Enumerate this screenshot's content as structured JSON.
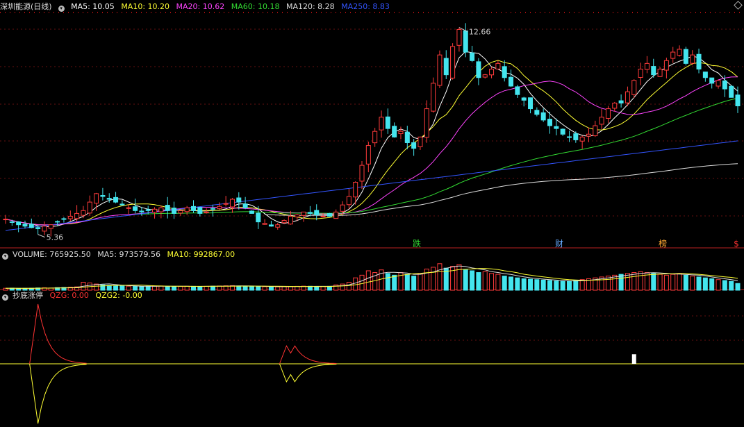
{
  "header": {
    "stock_name": "深圳能源",
    "period": "(日线)",
    "ma": [
      {
        "label": "MA5: 10.05",
        "color": "#ffffff"
      },
      {
        "label": "MA10: 10.20",
        "color": "#ffff33"
      },
      {
        "label": "MA20: 10.62",
        "color": "#ff44ff"
      },
      {
        "label": "MA60: 10.18",
        "color": "#33dd33"
      },
      {
        "label": "MA120: 8.28",
        "color": "#dddddd"
      },
      {
        "label": "MA250: 8.83",
        "color": "#3355ff"
      }
    ]
  },
  "volume_header": {
    "label": "VOLUME: 765925.50",
    "ma5": "MA5: 973579.56",
    "ma10": "MA10: 992867.00"
  },
  "indicator_header": {
    "name": "抄底涨停",
    "qzg": "QZG: 0.00",
    "qzg2": "QZG2: -0.00"
  },
  "chart_data": {
    "type": "candlestick",
    "high_label": "12.66",
    "low_label": "5.36",
    "markers": [
      {
        "text": "跌",
        "color": "#33dd33"
      },
      {
        "text": "财",
        "color": "#66aaff"
      },
      {
        "text": "榜",
        "color": "#ffaa33"
      },
      {
        "text": "$",
        "color": "#ff3333"
      }
    ],
    "price_range": [
      5.1,
      13.0
    ],
    "closes": [
      5.7,
      5.6,
      5.5,
      5.45,
      5.4,
      5.36,
      5.45,
      5.5,
      5.6,
      5.7,
      5.8,
      5.9,
      6.0,
      6.3,
      6.6,
      6.5,
      6.4,
      6.3,
      6.2,
      6.1,
      6.0,
      5.95,
      6.0,
      6.05,
      6.1,
      6.0,
      5.9,
      6.0,
      6.1,
      6.0,
      5.9,
      5.95,
      6.05,
      6.15,
      6.25,
      6.4,
      6.3,
      6.1,
      5.9,
      5.6,
      5.55,
      5.45,
      5.5,
      5.65,
      5.8,
      5.85,
      5.95,
      5.9,
      5.85,
      5.8,
      5.8,
      5.95,
      6.2,
      6.5,
      7.0,
      7.6,
      8.3,
      8.8,
      9.3,
      8.9,
      8.6,
      8.8,
      8.4,
      8.2,
      8.6,
      9.6,
      10.5,
      11.5,
      10.8,
      11.8,
      12.4,
      11.6,
      11.3,
      10.7,
      10.8,
      11.0,
      11.2,
      10.7,
      10.4,
      10.1,
      9.9,
      9.6,
      9.4,
      9.2,
      9.0,
      8.9,
      8.7,
      8.6,
      8.5,
      8.6,
      8.7,
      9.0,
      9.3,
      9.6,
      9.8,
      9.8,
      10.2,
      10.6,
      11.0,
      11.2,
      10.8,
      11.0,
      11.3,
      11.6,
      11.7,
      11.2,
      11.5,
      11.0,
      10.7,
      10.5,
      10.6,
      10.3,
      10.0,
      9.7
    ],
    "volume_range": [
      0,
      3300000
    ],
    "volumes": [
      220,
      240,
      200,
      210,
      230,
      260,
      280,
      250,
      300,
      320,
      350,
      380,
      900,
      820,
      700,
      600,
      550,
      500,
      480,
      460,
      430,
      420,
      440,
      460,
      480,
      440,
      420,
      430,
      450,
      440,
      430,
      440,
      460,
      480,
      500,
      520,
      480,
      460,
      450,
      420,
      400,
      390,
      380,
      400,
      420,
      440,
      460,
      450,
      430,
      420,
      440,
      600,
      700,
      900,
      1400,
      1700,
      2200,
      2000,
      2300,
      1900,
      1700,
      2000,
      1800,
      1600,
      1900,
      2400,
      2600,
      3000,
      2500,
      2700,
      2900,
      2300,
      2200,
      2000,
      2100,
      1900,
      1800,
      1600,
      1500,
      1400,
      1300,
      1250,
      1200,
      1150,
      1100,
      1050,
      1000,
      1000,
      1100,
      1200,
      1300,
      1400,
      1500,
      1600,
      1700,
      1800,
      1900,
      2000,
      2100,
      2000,
      1900,
      1800,
      1700,
      1800,
      1900,
      1700,
      1600,
      1500,
      1400,
      1300,
      1200,
      1100,
      1000,
      766
    ],
    "indicator": {
      "spike1_index": 5,
      "spike1_value": 1.0,
      "spike2_index": 44,
      "spike2_value": 0.3,
      "bar_index": 97,
      "bar_value": 0.16
    }
  }
}
